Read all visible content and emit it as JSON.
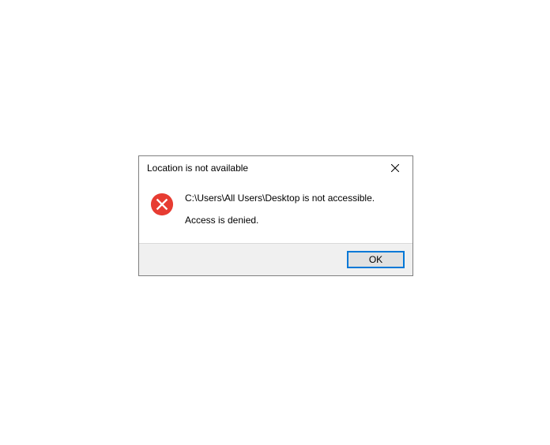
{
  "dialog": {
    "title": "Location is not available",
    "message_line1": "C:\\Users\\All Users\\Desktop is not accessible.",
    "message_line2": "Access is denied.",
    "ok_label": "OK"
  }
}
